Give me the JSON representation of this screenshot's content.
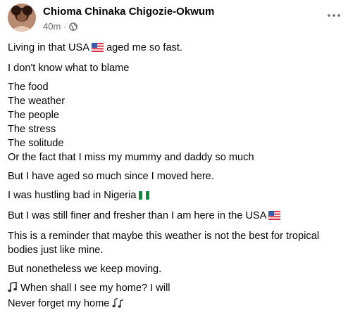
{
  "post": {
    "author": "Chioma Chinaka Chigozie-Okwum",
    "timestamp": "40m",
    "separator": "·",
    "audience_icon": "globe-icon",
    "more_icon": "more-options-icon",
    "paragraphs": [
      {
        "lines": [
          {
            "text": "Living in that USA",
            "emoji": "us-flag",
            "after": " aged me so fast."
          }
        ]
      },
      {
        "lines": [
          {
            "text": "I don't know what to blame"
          }
        ]
      },
      {
        "lines": [
          {
            "text": "The food"
          },
          {
            "text": "The weather"
          },
          {
            "text": "The people"
          },
          {
            "text": "The stress"
          },
          {
            "text": "The solitude"
          },
          {
            "text": "Or the fact that I miss my mummy and daddy so much"
          }
        ]
      },
      {
        "lines": [
          {
            "text": "But I have aged so much since I moved here."
          }
        ]
      },
      {
        "lines": [
          {
            "text": "I was hustling bad in Nigeria",
            "emoji": "nigeria-flag"
          }
        ]
      },
      {
        "lines": [
          {
            "text": "But I was still finer and fresher than I am here in the USA",
            "emoji": "us-flag"
          }
        ]
      },
      {
        "lines": [
          {
            "text": "This is a reminder that maybe this weather is not the best for tropical"
          },
          {
            "text": "bodies just like mine."
          }
        ]
      },
      {
        "lines": [
          {
            "text": "But nonetheless we keep moving."
          }
        ]
      },
      {
        "lines": [
          {
            "lead_emoji": "musical-note",
            "text": " When shall I see my home? I will"
          },
          {
            "text": "Never forget my home",
            "emoji": "musical-notes"
          }
        ]
      }
    ]
  },
  "colors": {
    "text": "#050505",
    "secondary_text": "#65676b"
  }
}
